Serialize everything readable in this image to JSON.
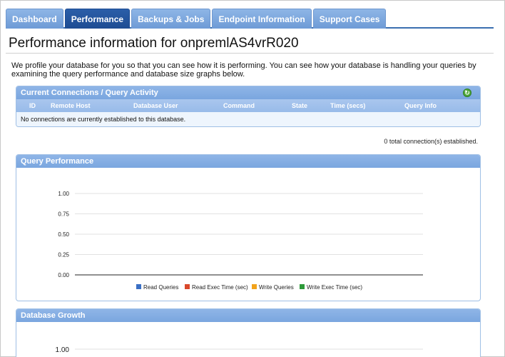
{
  "tabs": [
    {
      "label": "Dashboard"
    },
    {
      "label": "Performance"
    },
    {
      "label": "Backups & Jobs"
    },
    {
      "label": "Endpoint Information"
    },
    {
      "label": "Support Cases"
    }
  ],
  "active_tab": "Performance",
  "page_title": "Performance information for onpremlAS4vrR020",
  "intro_text": "We profile your database for you so that you can see how it is performing. You can see how your database is handling your queries by examining the query performance and database size graphs below.",
  "connections": {
    "title": "Current Connections / Query Activity",
    "refresh_icon": "refresh-icon",
    "columns": [
      "ID",
      "Remote Host",
      "Database User",
      "Command",
      "State",
      "Time (secs)",
      "Query Info"
    ],
    "empty_message": "No connections are currently established to this database.",
    "total_text": "0 total connection(s) established."
  },
  "query_performance": {
    "title": "Query Performance"
  },
  "database_growth": {
    "title": "Database Growth"
  },
  "chart_data": [
    {
      "type": "line",
      "title": "Query Performance",
      "xlabel": "",
      "ylabel": "",
      "ylim": [
        0,
        1
      ],
      "yticks": [
        "1.00",
        "0.75",
        "0.50",
        "0.25",
        "0.00"
      ],
      "series": [
        {
          "name": "Read Queries",
          "color": "#3a6fc4",
          "values": []
        },
        {
          "name": "Read Exec Time (sec)",
          "color": "#d9482b",
          "values": []
        },
        {
          "name": "Write Queries",
          "color": "#f2a31b",
          "values": []
        },
        {
          "name": "Write Exec Time (sec)",
          "color": "#2e9a3a",
          "values": []
        }
      ],
      "grid": true,
      "legend": "bottom"
    },
    {
      "type": "line",
      "title": "Database Growth",
      "ylim": [
        0,
        1
      ],
      "yticks": [
        "1.00"
      ],
      "series": [],
      "grid": true
    }
  ]
}
